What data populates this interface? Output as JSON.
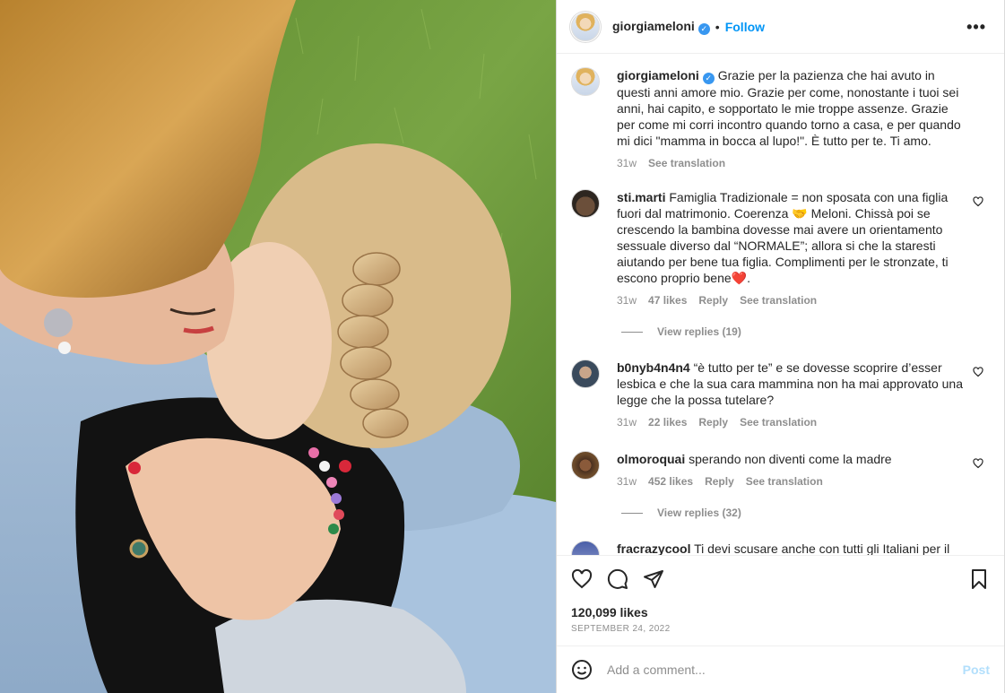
{
  "header": {
    "username": "giorgiameloni",
    "follow_label": "Follow",
    "separator": "•",
    "more_label": "•••"
  },
  "caption": {
    "username": "giorgiameloni",
    "text": "Grazie per la pazienza che hai avuto in questi anni amore mio. Grazie per come, nonostante i tuoi sei anni, hai capito, e sopportato le mie troppe assenze. Grazie per come mi corri incontro quando torno a casa, e per quando mi dici \"mamma in bocca al lupo!\". È tutto per te. Ti amo.",
    "time": "31w",
    "translate": "See translation"
  },
  "comments": [
    {
      "username": "sti.marti",
      "text": "Famiglia Tradizionale = non sposata con una figlia fuori dal matrimonio. Coerenza 🤝 Meloni. Chissà poi se crescendo la bambina dovesse mai avere un orientamento sessuale diverso dal “NORMALE”; allora si che la staresti aiutando per bene tua figlia. Complimenti per le stronzate, ti escono proprio bene❤️.",
      "time": "31w",
      "likes": "47 likes",
      "reply": "Reply",
      "translate": "See translation",
      "view_replies": "View replies (19)"
    },
    {
      "username": "b0nyb4n4n4",
      "text": "“è tutto per te” e se dovesse scoprire d’esser lesbica e che la sua cara mammina non ha mai approvato una legge che la possa tutelare?",
      "time": "31w",
      "likes": "22 likes",
      "reply": "Reply",
      "translate": "See translation"
    },
    {
      "username": "olmoroquai",
      "text": "sperando non diventi come la madre",
      "time": "31w",
      "likes": "452 likes",
      "reply": "Reply",
      "translate": "See translation",
      "view_replies": "View replies (32)"
    },
    {
      "username": "fracrazycool",
      "text": "Ti devi scusare anche con tutti gli Italiani per il"
    }
  ],
  "footer": {
    "likes": "120,099 likes",
    "date": "SEPTEMBER 24, 2022",
    "comment_placeholder": "Add a comment...",
    "post_label": "Post"
  }
}
